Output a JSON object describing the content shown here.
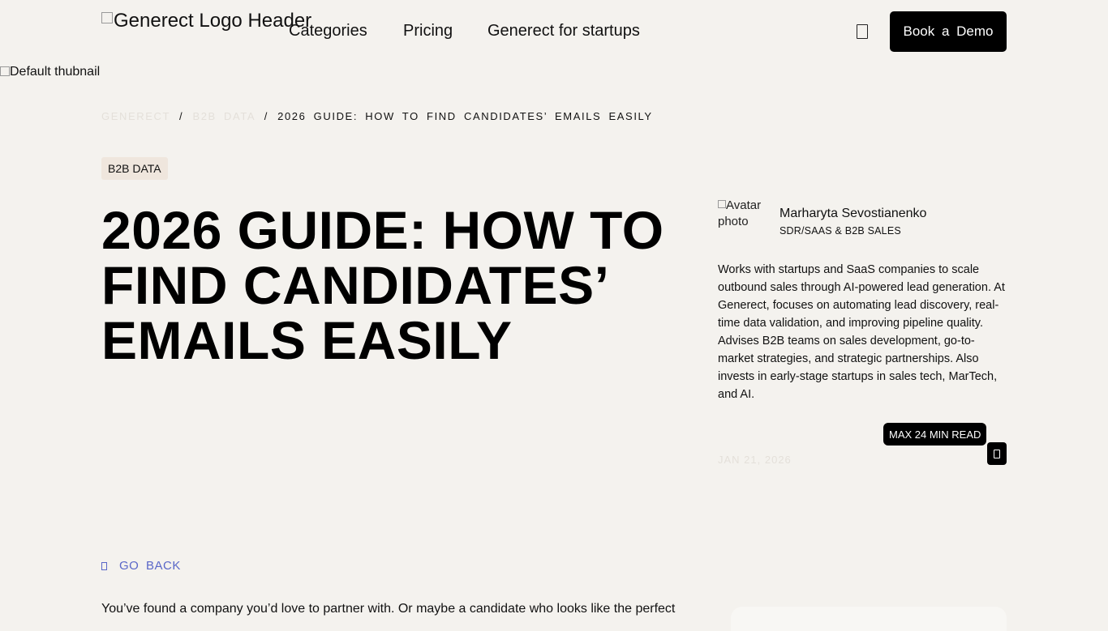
{
  "header": {
    "logo_alt": "Generect Logo Header",
    "nav": [
      "Categories",
      "Pricing",
      "Generect for startups"
    ],
    "search_icon": "search-icon",
    "cta_label": "Book a Demo"
  },
  "thumbnail_alt": "Default thubnail",
  "breadcrumb": {
    "home": "GENERECT",
    "category": "B2B DATA",
    "separator": "/",
    "current": "2026 GUIDE: HOW TO FIND CANDIDATES’ EMAILS EASILY"
  },
  "article": {
    "category_badge": "B2B DATA",
    "title": "2026 GUIDE: HOW TO FIND CANDIDATES’ EMAILS EASILY",
    "intro": "You’ve found a company you’d love to partner with. Or maybe a candidate who looks like the perfect"
  },
  "author": {
    "avatar_alt": "Avatar photo",
    "name": "Marharyta Sevostianenko",
    "role": "SDR/SAAS & B2B SALES",
    "bio": "Works with startups and SaaS companies to scale outbound sales through AI-powered lead generation. At Generect, focuses on automating lead discovery, real-time data validation, and improving pipeline quality. Advises B2B teams on sales development, go-to-market strategies, and strategic partnerships. Also invests in early-stage startups in sales tech, MarTech, and AI."
  },
  "meta": {
    "read_time": "MAX 24 MIN READ",
    "date": "JAN 21, 2026",
    "share_icon": "share-icon"
  },
  "go_back_label": "GO BACK"
}
